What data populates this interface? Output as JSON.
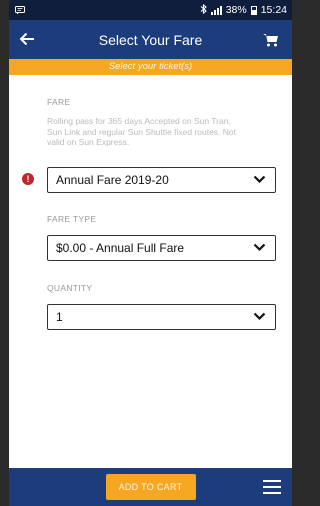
{
  "status_bar": {
    "percent": "38%",
    "time": "15:24"
  },
  "header": {
    "title": "Select Your Fare",
    "back_icon": "arrow-left-icon",
    "cart_icon": "cart-icon"
  },
  "banner": {
    "text": "Select your ticket(s)"
  },
  "fare": {
    "label": "FARE",
    "description": "Rolling pass for 365 days Accepted on Sun Tran, Sun Link and  regular Sun Shuttle fixed routes. Not valid on Sun Express.",
    "selected": "Annual Fare 2019-20",
    "error_icon_text": "!"
  },
  "fare_type": {
    "label": "FARE TYPE",
    "selected": "$0.00 - Annual Full Fare"
  },
  "quantity": {
    "label": "QUANTITY",
    "selected": "1"
  },
  "footer": {
    "add_to_cart_label": "ADD TO CART",
    "menu_icon": "hamburger-menu-icon"
  },
  "colors": {
    "header_bg": "#1c3c7c",
    "status_bg": "#0f1e3d",
    "accent": "#f5a623",
    "error": "#c0272d"
  }
}
